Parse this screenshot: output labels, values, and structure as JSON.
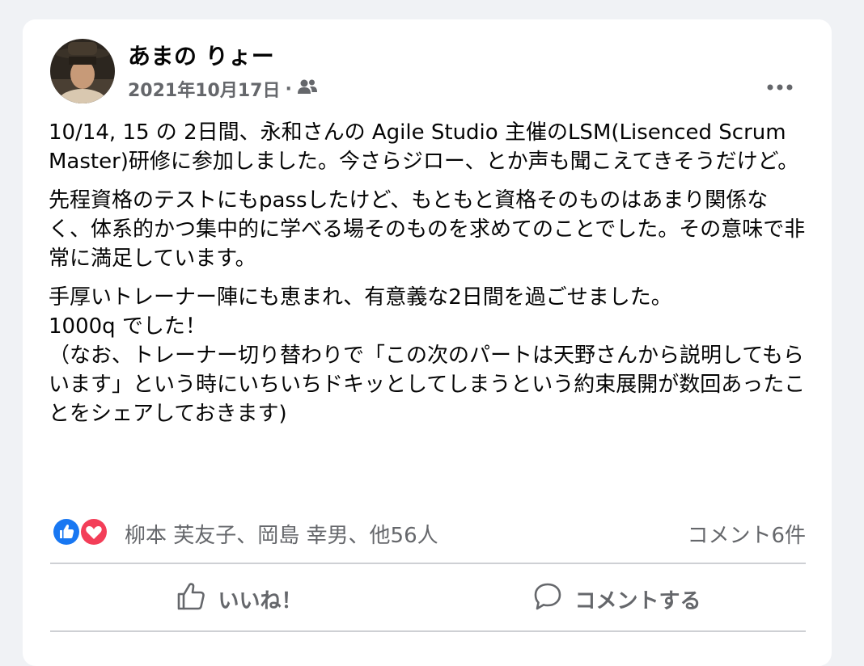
{
  "post": {
    "author": "あまの りょー",
    "date": "2021年10月17日",
    "separator": "·",
    "audience_icon": "friends-icon",
    "paragraphs": [
      "10/14, 15 の 2日間、永和さんの Agile Studio 主催のLSM(Lisenced Scrum Master)研修に参加しました。今さらジロー、とか声も聞こえてきそうだけど。",
      "先程資格のテストにもpassしたけど、もともと資格そのものはあまり関係なく、体系的かつ集中的に学べる場そのものを求めてのことでした。その意味で非常に満足しています。",
      "手厚いトレーナー陣にも恵まれ、有意義な2日間を過ごせました。\n1000q でした！\n（なお、トレーナー切り替わりで「この次のパートは天野さんから説明してもらいます」という時にいちいちドキッとしてしまうという約束展開が数回あったことをシェアしておきます)"
    ]
  },
  "reactions": {
    "names": "柳本 芙友子、岡島 幸男、他56人",
    "comments": "コメント6件",
    "like_color": "#1877f2",
    "love_color": "#f33e58"
  },
  "actions": {
    "like_label": "いいね！",
    "comment_label": "コメントする"
  }
}
